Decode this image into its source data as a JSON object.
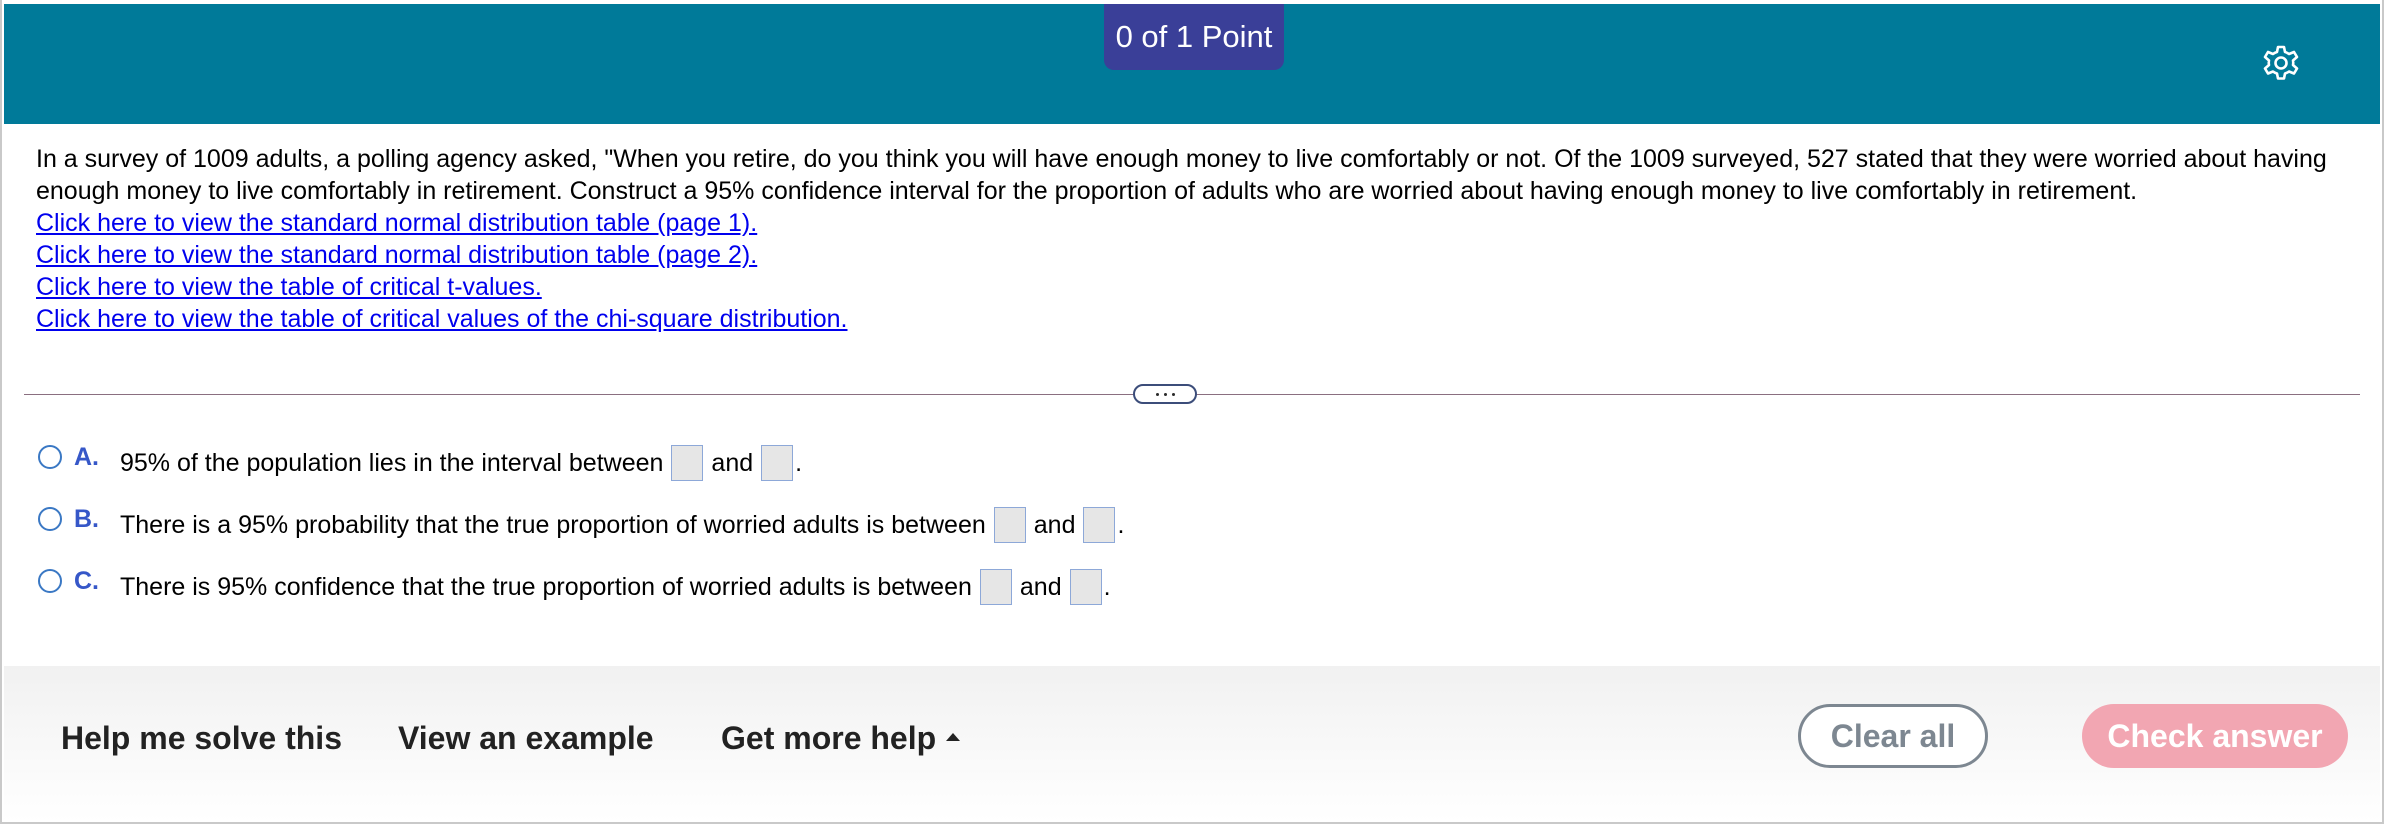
{
  "header": {
    "score": "0 of 1 Point",
    "settings_icon": "gear-icon",
    "background": "#007a99",
    "pill_background": "#3a3f98"
  },
  "question": {
    "text": "In a survey of 1009 adults, a polling agency asked, \"When you retire, do you think you will have enough money to live comfortably or not. Of the 1009 surveyed, 527 stated that they were worried about having enough money to live comfortably in retirement. Construct a 95% confidence interval for the proportion of adults who are worried about having enough money to live comfortably in retirement.",
    "links": [
      "Click here to view the standard normal distribution table (page 1).",
      "Click here to view the standard normal distribution table (page 2).",
      "Click here to view the table of critical t-values.",
      "Click here to view the table of critical values of the chi-square distribution."
    ]
  },
  "expander_icon": "ellipsis-icon",
  "choices": [
    {
      "letter": "A.",
      "text": "95% of the population lies in the interval between",
      "and": "and",
      "end": "."
    },
    {
      "letter": "B.",
      "text": "There is a 95% probability that the true proportion of worried adults is between",
      "and": "and",
      "end": "."
    },
    {
      "letter": "C.",
      "text": "There is 95% confidence that the true proportion of worried adults is between",
      "and": "and",
      "end": "."
    }
  ],
  "footer": {
    "help": "Help me solve this",
    "example": "View an example",
    "more_help": "Get more help",
    "more_help_icon": "caret-up-icon",
    "clear": "Clear all",
    "check": "Check answer",
    "check_color": "#f2a6b2"
  }
}
